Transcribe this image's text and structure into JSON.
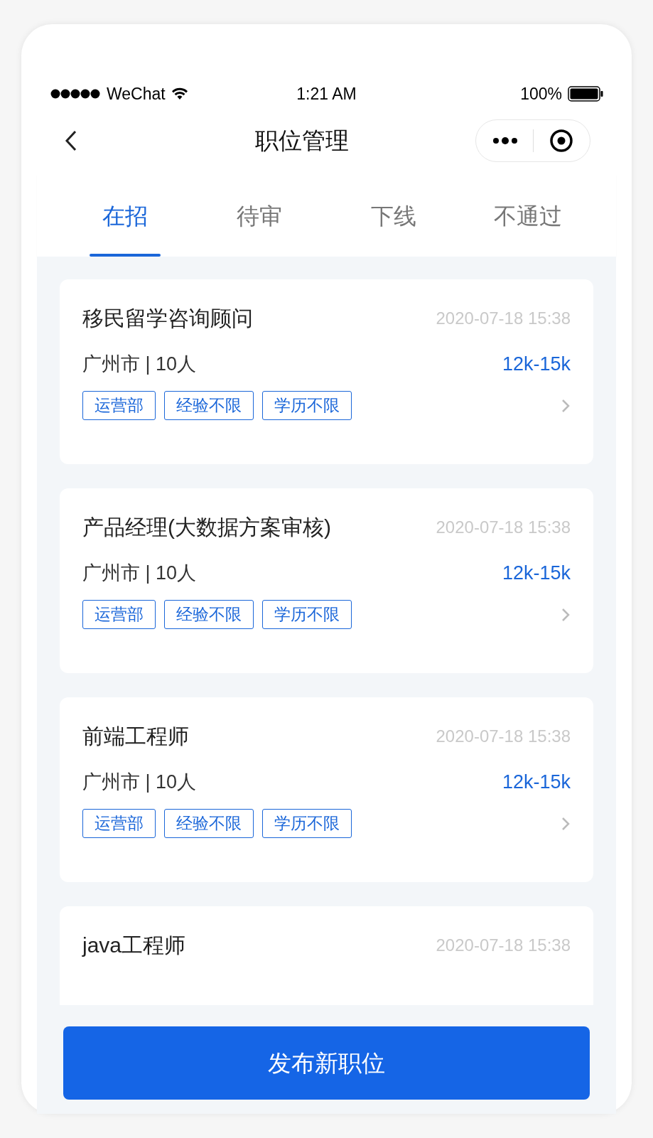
{
  "status_bar": {
    "carrier": "WeChat",
    "time": "1:21 AM",
    "battery": "100%"
  },
  "nav": {
    "title": "职位管理"
  },
  "tabs": [
    {
      "label": "在招",
      "selected": true
    },
    {
      "label": "待审",
      "selected": false
    },
    {
      "label": "下线",
      "selected": false
    },
    {
      "label": "不通过",
      "selected": false
    }
  ],
  "jobs": [
    {
      "title": "移民留学咨询顾问",
      "date": "2020-07-18 15:38",
      "location": "广州市 | 10人",
      "salary": "12k-15k",
      "tags": [
        "运营部",
        "经验不限",
        "学历不限"
      ]
    },
    {
      "title": "产品经理(大数据方案审核)",
      "date": "2020-07-18 15:38",
      "location": "广州市 | 10人",
      "salary": "12k-15k",
      "tags": [
        "运营部",
        "经验不限",
        "学历不限"
      ]
    },
    {
      "title": "前端工程师",
      "date": "2020-07-18 15:38",
      "location": "广州市 | 10人",
      "salary": "12k-15k",
      "tags": [
        "运营部",
        "经验不限",
        "学历不限"
      ]
    },
    {
      "title": "java工程师",
      "date": "2020-07-18 15:38"
    }
  ],
  "button": "发布新职位"
}
